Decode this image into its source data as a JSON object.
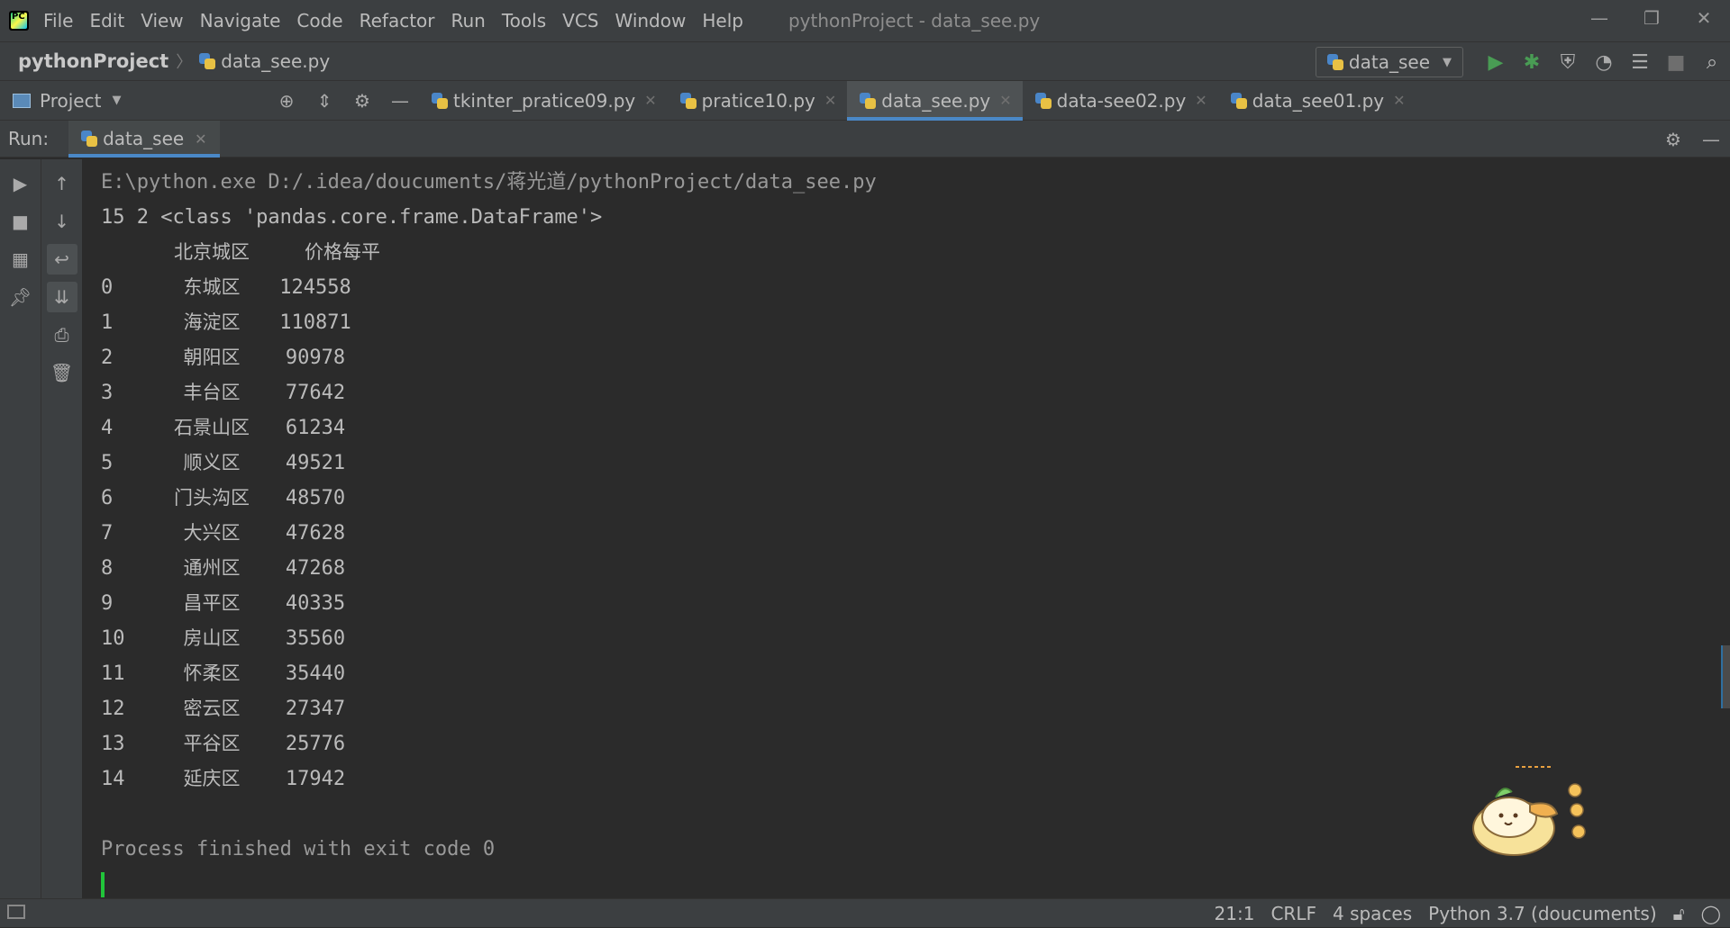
{
  "menu": [
    "File",
    "Edit",
    "View",
    "Navigate",
    "Code",
    "Refactor",
    "Run",
    "Tools",
    "VCS",
    "Window",
    "Help"
  ],
  "window_title": "pythonProject - data_see.py",
  "breadcrumb": {
    "project": "pythonProject",
    "file": "data_see.py"
  },
  "run_config": "data_see",
  "project_tool": "Project",
  "tabs": [
    {
      "label": "tkinter_pratice09.py",
      "active": false
    },
    {
      "label": "pratice10.py",
      "active": false
    },
    {
      "label": "data_see.py",
      "active": true
    },
    {
      "label": "data-see02.py",
      "active": false
    },
    {
      "label": "data_see01.py",
      "active": false
    }
  ],
  "run_panel": {
    "label": "Run:",
    "tab": "data_see"
  },
  "console": {
    "command": "E:\\python.exe D:/.idea/doucuments/蒋光道/pythonProject/data_see.py",
    "shape_line": "15 2 <class 'pandas.core.frame.DataFrame'>",
    "columns": [
      "北京城区",
      "价格每平"
    ],
    "rows": [
      {
        "index": "0",
        "district": "东城区",
        "price": "124558"
      },
      {
        "index": "1",
        "district": "海淀区",
        "price": "110871"
      },
      {
        "index": "2",
        "district": "朝阳区",
        "price": "90978"
      },
      {
        "index": "3",
        "district": "丰台区",
        "price": "77642"
      },
      {
        "index": "4",
        "district": "石景山区",
        "price": "61234"
      },
      {
        "index": "5",
        "district": "顺义区",
        "price": "49521"
      },
      {
        "index": "6",
        "district": "门头沟区",
        "price": "48570"
      },
      {
        "index": "7",
        "district": "大兴区",
        "price": "47628"
      },
      {
        "index": "8",
        "district": "通州区",
        "price": "47268"
      },
      {
        "index": "9",
        "district": "昌平区",
        "price": "40335"
      },
      {
        "index": "10",
        "district": "房山区",
        "price": "35560"
      },
      {
        "index": "11",
        "district": "怀柔区",
        "price": "35440"
      },
      {
        "index": "12",
        "district": "密云区",
        "price": "27347"
      },
      {
        "index": "13",
        "district": "平谷区",
        "price": "25776"
      },
      {
        "index": "14",
        "district": "延庆区",
        "price": "17942"
      }
    ],
    "finished": "Process finished with exit code 0"
  },
  "status": {
    "position": "21:1",
    "line_ending": "CRLF",
    "indent": "4 spaces",
    "interpreter": "Python 3.7 (doucuments)"
  },
  "colors": {
    "accent": "#4a88c7",
    "run_green": "#499c54",
    "background": "#2b2b2b",
    "panel": "#3c3f41"
  }
}
